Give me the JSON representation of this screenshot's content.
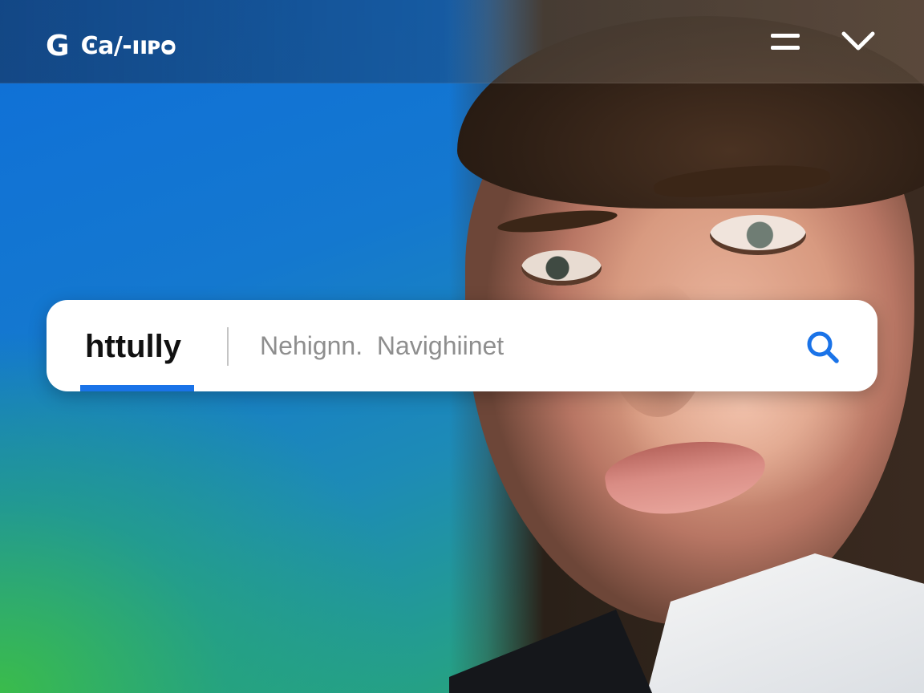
{
  "header": {
    "logo_letter": "G",
    "logo_text": "Ͼa/-ııᴘᴑ",
    "menu_icon": "hamburger-icon",
    "dropdown_icon": "chevron-down-icon"
  },
  "search": {
    "active_tab_label": "httully",
    "placeholder": "Nehignn.  Navighiinet",
    "search_icon": "search-icon"
  },
  "colors": {
    "accent": "#1a73e8",
    "header_text": "#ffffff",
    "background_blue": "#0f6fd9",
    "background_green": "#39b54a"
  }
}
